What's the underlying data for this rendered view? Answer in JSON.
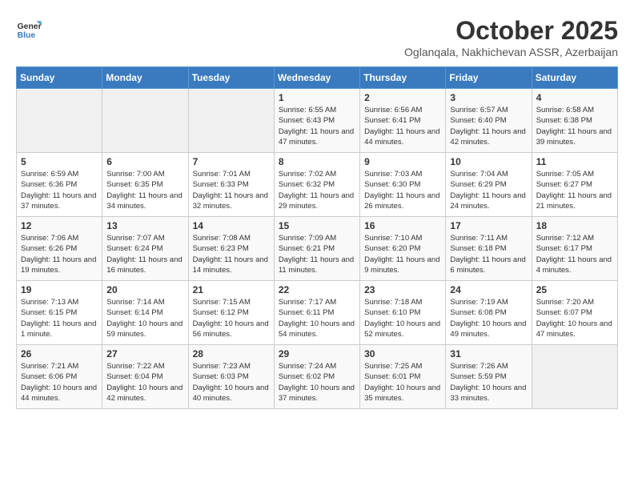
{
  "header": {
    "logo_line1": "General",
    "logo_line2": "Blue",
    "month_title": "October 2025",
    "subtitle": "Oglanqala, Nakhichevan ASSR, Azerbaijan"
  },
  "weekdays": [
    "Sunday",
    "Monday",
    "Tuesday",
    "Wednesday",
    "Thursday",
    "Friday",
    "Saturday"
  ],
  "weeks": [
    [
      {
        "day": "",
        "sunrise": "",
        "sunset": "",
        "daylight": ""
      },
      {
        "day": "",
        "sunrise": "",
        "sunset": "",
        "daylight": ""
      },
      {
        "day": "",
        "sunrise": "",
        "sunset": "",
        "daylight": ""
      },
      {
        "day": "1",
        "sunrise": "Sunrise: 6:55 AM",
        "sunset": "Sunset: 6:43 PM",
        "daylight": "Daylight: 11 hours and 47 minutes."
      },
      {
        "day": "2",
        "sunrise": "Sunrise: 6:56 AM",
        "sunset": "Sunset: 6:41 PM",
        "daylight": "Daylight: 11 hours and 44 minutes."
      },
      {
        "day": "3",
        "sunrise": "Sunrise: 6:57 AM",
        "sunset": "Sunset: 6:40 PM",
        "daylight": "Daylight: 11 hours and 42 minutes."
      },
      {
        "day": "4",
        "sunrise": "Sunrise: 6:58 AM",
        "sunset": "Sunset: 6:38 PM",
        "daylight": "Daylight: 11 hours and 39 minutes."
      }
    ],
    [
      {
        "day": "5",
        "sunrise": "Sunrise: 6:59 AM",
        "sunset": "Sunset: 6:36 PM",
        "daylight": "Daylight: 11 hours and 37 minutes."
      },
      {
        "day": "6",
        "sunrise": "Sunrise: 7:00 AM",
        "sunset": "Sunset: 6:35 PM",
        "daylight": "Daylight: 11 hours and 34 minutes."
      },
      {
        "day": "7",
        "sunrise": "Sunrise: 7:01 AM",
        "sunset": "Sunset: 6:33 PM",
        "daylight": "Daylight: 11 hours and 32 minutes."
      },
      {
        "day": "8",
        "sunrise": "Sunrise: 7:02 AM",
        "sunset": "Sunset: 6:32 PM",
        "daylight": "Daylight: 11 hours and 29 minutes."
      },
      {
        "day": "9",
        "sunrise": "Sunrise: 7:03 AM",
        "sunset": "Sunset: 6:30 PM",
        "daylight": "Daylight: 11 hours and 26 minutes."
      },
      {
        "day": "10",
        "sunrise": "Sunrise: 7:04 AM",
        "sunset": "Sunset: 6:29 PM",
        "daylight": "Daylight: 11 hours and 24 minutes."
      },
      {
        "day": "11",
        "sunrise": "Sunrise: 7:05 AM",
        "sunset": "Sunset: 6:27 PM",
        "daylight": "Daylight: 11 hours and 21 minutes."
      }
    ],
    [
      {
        "day": "12",
        "sunrise": "Sunrise: 7:06 AM",
        "sunset": "Sunset: 6:26 PM",
        "daylight": "Daylight: 11 hours and 19 minutes."
      },
      {
        "day": "13",
        "sunrise": "Sunrise: 7:07 AM",
        "sunset": "Sunset: 6:24 PM",
        "daylight": "Daylight: 11 hours and 16 minutes."
      },
      {
        "day": "14",
        "sunrise": "Sunrise: 7:08 AM",
        "sunset": "Sunset: 6:23 PM",
        "daylight": "Daylight: 11 hours and 14 minutes."
      },
      {
        "day": "15",
        "sunrise": "Sunrise: 7:09 AM",
        "sunset": "Sunset: 6:21 PM",
        "daylight": "Daylight: 11 hours and 11 minutes."
      },
      {
        "day": "16",
        "sunrise": "Sunrise: 7:10 AM",
        "sunset": "Sunset: 6:20 PM",
        "daylight": "Daylight: 11 hours and 9 minutes."
      },
      {
        "day": "17",
        "sunrise": "Sunrise: 7:11 AM",
        "sunset": "Sunset: 6:18 PM",
        "daylight": "Daylight: 11 hours and 6 minutes."
      },
      {
        "day": "18",
        "sunrise": "Sunrise: 7:12 AM",
        "sunset": "Sunset: 6:17 PM",
        "daylight": "Daylight: 11 hours and 4 minutes."
      }
    ],
    [
      {
        "day": "19",
        "sunrise": "Sunrise: 7:13 AM",
        "sunset": "Sunset: 6:15 PM",
        "daylight": "Daylight: 11 hours and 1 minute."
      },
      {
        "day": "20",
        "sunrise": "Sunrise: 7:14 AM",
        "sunset": "Sunset: 6:14 PM",
        "daylight": "Daylight: 10 hours and 59 minutes."
      },
      {
        "day": "21",
        "sunrise": "Sunrise: 7:15 AM",
        "sunset": "Sunset: 6:12 PM",
        "daylight": "Daylight: 10 hours and 56 minutes."
      },
      {
        "day": "22",
        "sunrise": "Sunrise: 7:17 AM",
        "sunset": "Sunset: 6:11 PM",
        "daylight": "Daylight: 10 hours and 54 minutes."
      },
      {
        "day": "23",
        "sunrise": "Sunrise: 7:18 AM",
        "sunset": "Sunset: 6:10 PM",
        "daylight": "Daylight: 10 hours and 52 minutes."
      },
      {
        "day": "24",
        "sunrise": "Sunrise: 7:19 AM",
        "sunset": "Sunset: 6:08 PM",
        "daylight": "Daylight: 10 hours and 49 minutes."
      },
      {
        "day": "25",
        "sunrise": "Sunrise: 7:20 AM",
        "sunset": "Sunset: 6:07 PM",
        "daylight": "Daylight: 10 hours and 47 minutes."
      }
    ],
    [
      {
        "day": "26",
        "sunrise": "Sunrise: 7:21 AM",
        "sunset": "Sunset: 6:06 PM",
        "daylight": "Daylight: 10 hours and 44 minutes."
      },
      {
        "day": "27",
        "sunrise": "Sunrise: 7:22 AM",
        "sunset": "Sunset: 6:04 PM",
        "daylight": "Daylight: 10 hours and 42 minutes."
      },
      {
        "day": "28",
        "sunrise": "Sunrise: 7:23 AM",
        "sunset": "Sunset: 6:03 PM",
        "daylight": "Daylight: 10 hours and 40 minutes."
      },
      {
        "day": "29",
        "sunrise": "Sunrise: 7:24 AM",
        "sunset": "Sunset: 6:02 PM",
        "daylight": "Daylight: 10 hours and 37 minutes."
      },
      {
        "day": "30",
        "sunrise": "Sunrise: 7:25 AM",
        "sunset": "Sunset: 6:01 PM",
        "daylight": "Daylight: 10 hours and 35 minutes."
      },
      {
        "day": "31",
        "sunrise": "Sunrise: 7:26 AM",
        "sunset": "Sunset: 5:59 PM",
        "daylight": "Daylight: 10 hours and 33 minutes."
      },
      {
        "day": "",
        "sunrise": "",
        "sunset": "",
        "daylight": ""
      }
    ]
  ]
}
